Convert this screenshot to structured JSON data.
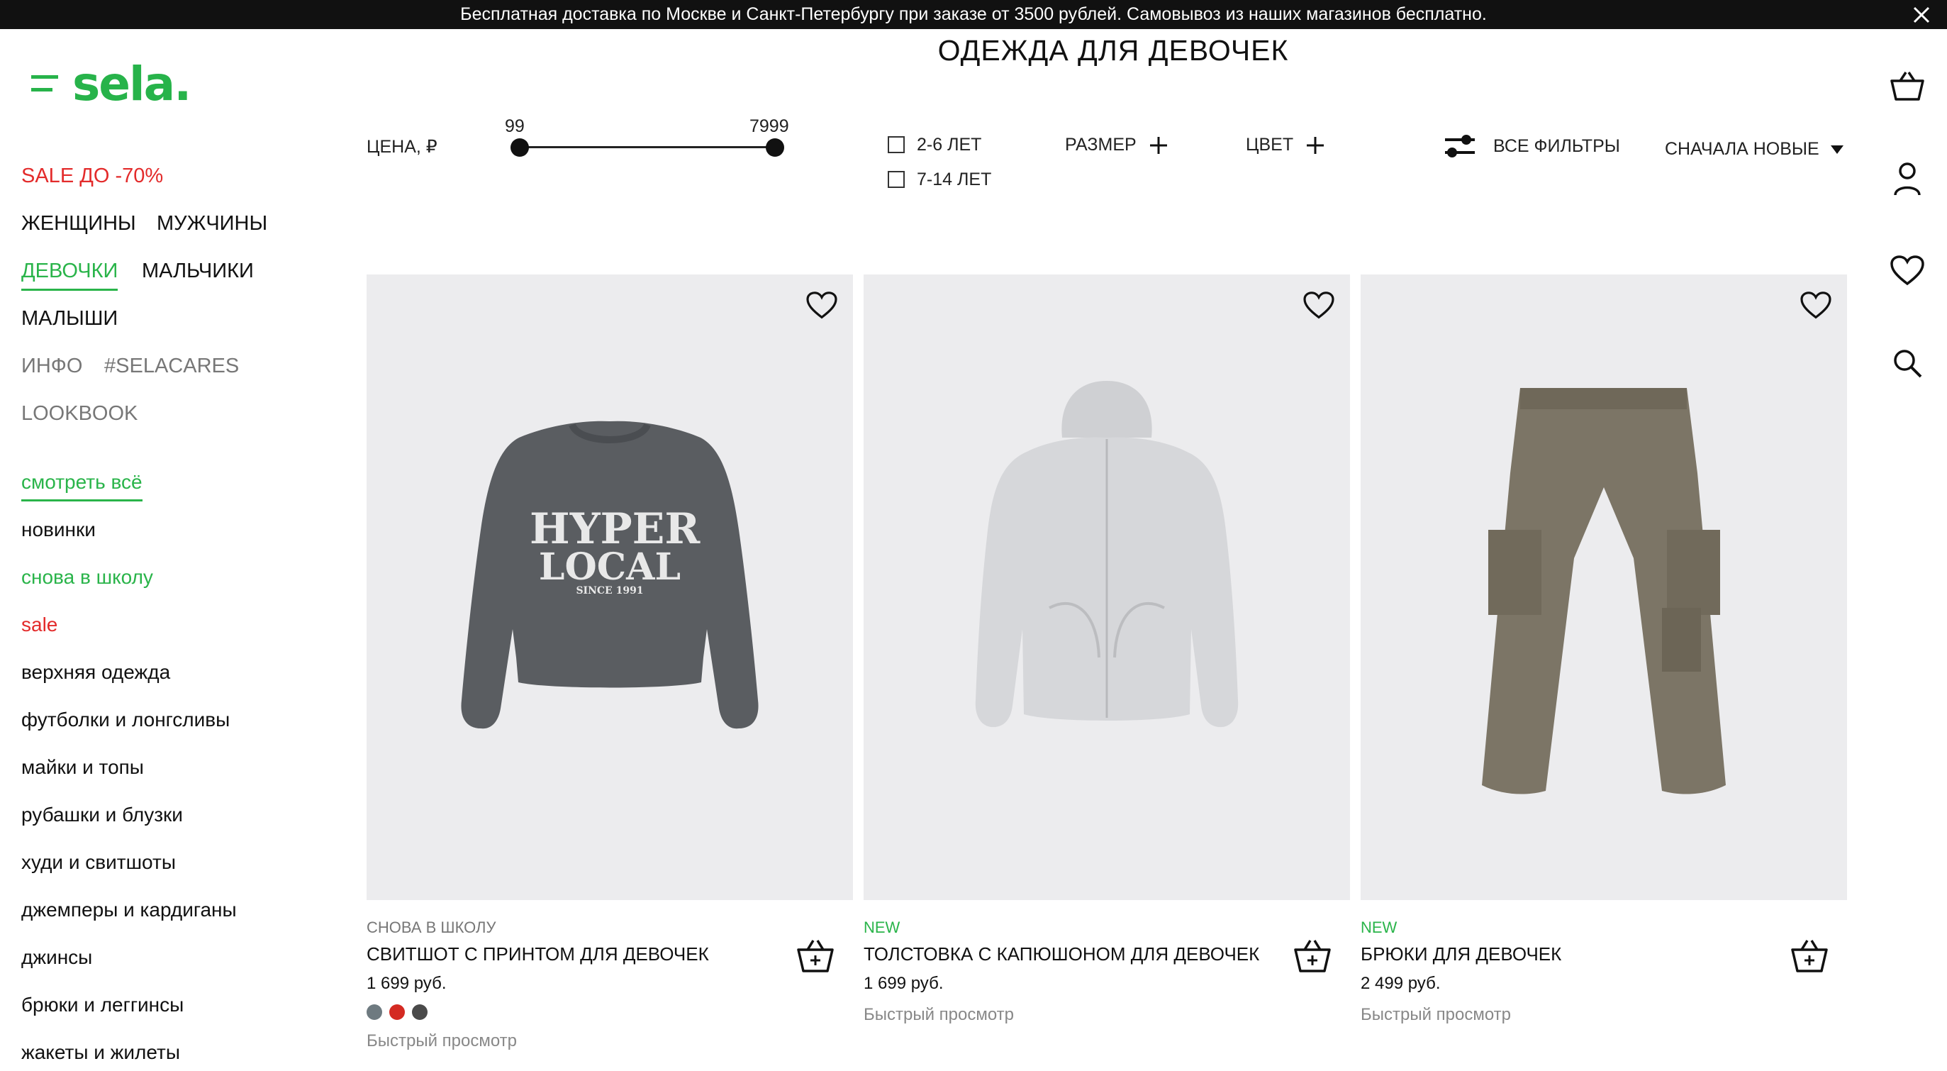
{
  "banner": {
    "text": "Бесплатная доставка по Москве и Санкт-Петербургу при заказе от 3500 рублей. Самовывоз из наших магазинов бесплатно."
  },
  "logo": {
    "text": "sela."
  },
  "page_title": "ОДЕЖДА ДЛЯ ДЕВОЧЕК",
  "nav": {
    "sale": "SALE ДО -70%",
    "women": "ЖЕНЩИНЫ",
    "men": "МУЖЧИНЫ",
    "girls": "ДЕВОЧКИ",
    "boys": "МАЛЬЧИКИ",
    "babies": "МАЛЫШИ",
    "info": "ИНФО",
    "selacares": "#SELACARES",
    "lookbook": "LOOKBOOK"
  },
  "categories": [
    "смотреть всё",
    "новинки",
    "снова в школу",
    "sale",
    "верхняя одежда",
    "футболки и лонгсливы",
    "майки и топы",
    "рубашки и блузки",
    "худи и свитшоты",
    "джемперы и кардиганы",
    "джинсы",
    "брюки и леггинсы",
    "жакеты и жилеты"
  ],
  "filters": {
    "price_label": "ЦЕНА, ₽",
    "price_min": "99",
    "price_max": "7999",
    "age_options": [
      "2-6 ЛЕТ",
      "7-14 ЛЕТ"
    ],
    "size_label": "РАЗМЕР",
    "color_label": "ЦВЕТ",
    "all_filters": "ВСЕ ФИЛЬТРЫ",
    "sort": "СНАЧАЛА НОВЫЕ"
  },
  "right_icons": [
    "basket-icon",
    "user-icon",
    "heart-icon",
    "search-icon"
  ],
  "products": [
    {
      "tag": "СНОВА В ШКОЛУ",
      "name": "СВИТШОТ С ПРИНТОМ ДЛЯ ДЕВОЧЕК",
      "price": "1 699 руб.",
      "quick_view": "Быстрый просмотр",
      "print_line1": "HYPER",
      "print_line2": "LOCAL",
      "print_line3": "SINCE 1991",
      "swatches": [
        "#6e7a80",
        "#d42a22",
        "#4a4a4a"
      ]
    },
    {
      "tag": "NEW",
      "name": "ТОЛСТОВКА С КАПЮШОНОМ ДЛЯ ДЕВОЧЕК",
      "price": "1 699 руб.",
      "quick_view": "Быстрый просмотр"
    },
    {
      "tag": "NEW",
      "name": "БРЮКИ ДЛЯ ДЕВОЧЕК",
      "price": "2 499 руб.",
      "quick_view": "Быстрый просмотр"
    }
  ],
  "colors": {
    "brand_green": "#27b34a",
    "sale_red": "#e32b2b",
    "tag_gray": "#777777"
  }
}
